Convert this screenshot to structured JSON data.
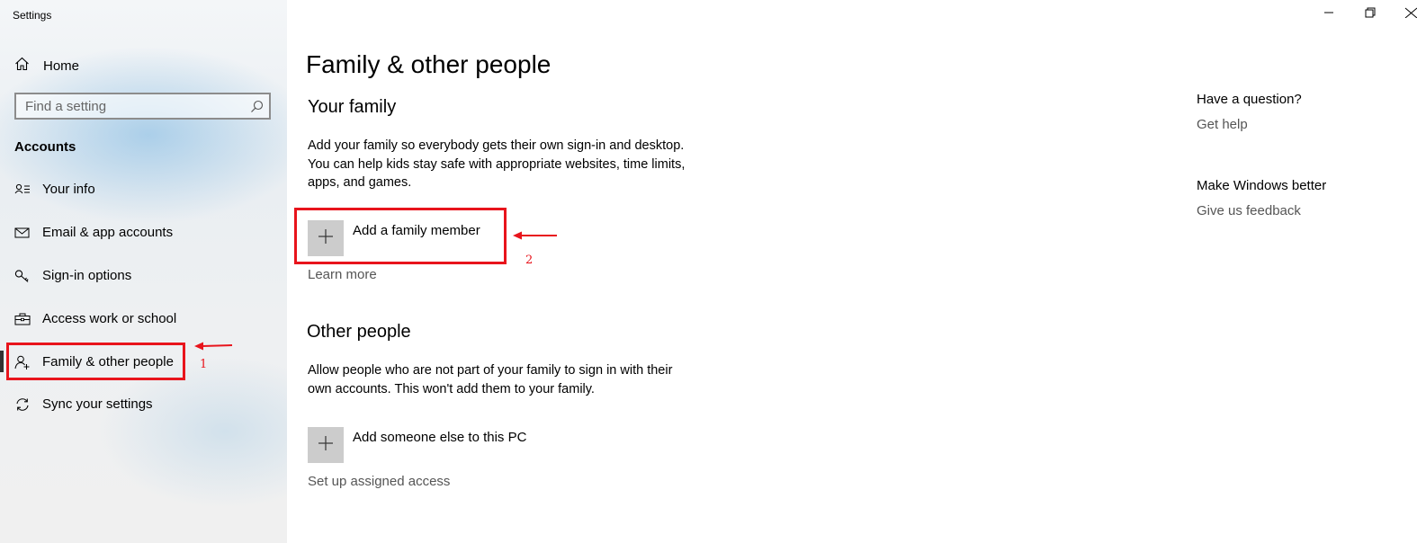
{
  "window": {
    "title": "Settings",
    "controls": {
      "minimize": "minimize-icon",
      "restore": "restore-icon",
      "close": "close-icon"
    }
  },
  "sidebar": {
    "home_label": "Home",
    "search_placeholder": "Find a setting",
    "section_title": "Accounts",
    "items": [
      {
        "label": "Your info",
        "icon": "contact-card-icon"
      },
      {
        "label": "Email & app accounts",
        "icon": "mail-icon"
      },
      {
        "label": "Sign-in options",
        "icon": "key-icon"
      },
      {
        "label": "Access work or school",
        "icon": "briefcase-icon"
      },
      {
        "label": "Family & other people",
        "icon": "add-person-icon",
        "selected": true
      },
      {
        "label": "Sync your settings",
        "icon": "sync-icon"
      }
    ]
  },
  "main": {
    "title": "Family & other people",
    "family": {
      "heading": "Your family",
      "description_lines": [
        "Add your family so everybody gets their own sign-in and desktop.",
        "You can help kids stay safe with appropriate websites, time limits,",
        "apps, and games."
      ],
      "add_label": "Add a family member",
      "learn_more": "Learn more"
    },
    "other": {
      "heading": "Other people",
      "description_lines": [
        "Allow people who are not part of your family to sign in with their",
        "own accounts. This won't add them to your family."
      ],
      "add_label": "Add someone else to this PC",
      "assigned_access": "Set up assigned access"
    }
  },
  "right_panel": {
    "question_heading": "Have a question?",
    "get_help": "Get help",
    "feedback_heading": "Make Windows better",
    "feedback_link": "Give us feedback"
  },
  "annotations": {
    "color": "#e8141c",
    "step1": "1",
    "step2": "2"
  }
}
